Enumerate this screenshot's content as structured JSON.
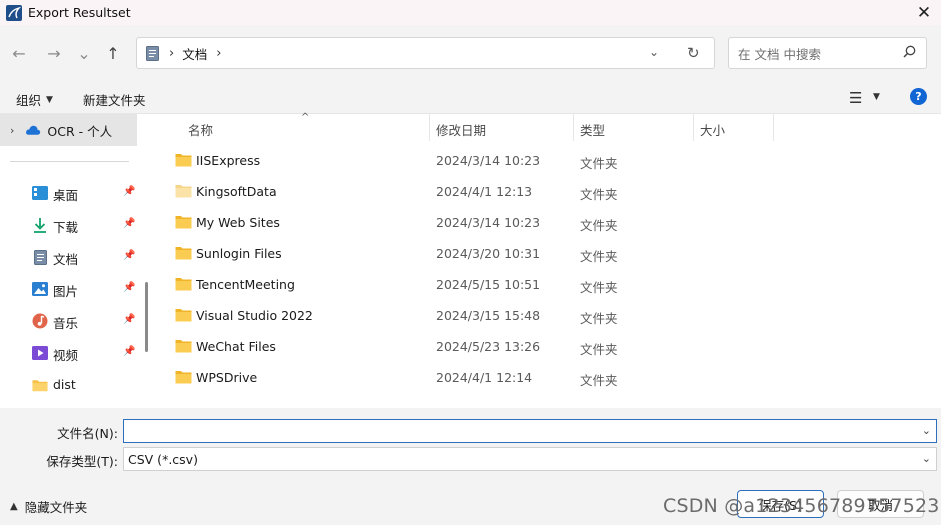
{
  "window": {
    "title": "Export Resultset",
    "close_label": "✕"
  },
  "nav": {
    "back": "←",
    "forward": "→",
    "recent": "⌄",
    "up": "↑",
    "address": {
      "separator": "›",
      "location": "文档",
      "trail": "›"
    },
    "search_placeholder": "在 文档 中搜索"
  },
  "toolbar": {
    "organize": "组织",
    "new_folder": "新建文件夹",
    "caret": "▼"
  },
  "sidebar": {
    "ocr_label": "OCR - 个人",
    "items": [
      {
        "label": "桌面",
        "icon": "desktop-icon",
        "pinned": true
      },
      {
        "label": "下载",
        "icon": "download-icon",
        "pinned": true
      },
      {
        "label": "文档",
        "icon": "documents-icon",
        "pinned": true
      },
      {
        "label": "图片",
        "icon": "pictures-icon",
        "pinned": true
      },
      {
        "label": "音乐",
        "icon": "music-icon",
        "pinned": true
      },
      {
        "label": "视频",
        "icon": "videos-icon",
        "pinned": true
      },
      {
        "label": "dist",
        "icon": "folder-icon",
        "pinned": false
      }
    ]
  },
  "columns": {
    "name": "名称",
    "date": "修改日期",
    "type": "类型",
    "size": "大小"
  },
  "files": [
    {
      "name": "IISExpress",
      "date": "2024/3/14 10:23",
      "type": "文件夹"
    },
    {
      "name": "KingsoftData",
      "date": "2024/4/1 12:13",
      "type": "文件夹"
    },
    {
      "name": "My Web Sites",
      "date": "2024/3/14 10:23",
      "type": "文件夹"
    },
    {
      "name": "Sunlogin Files",
      "date": "2024/3/20 10:31",
      "type": "文件夹"
    },
    {
      "name": "TencentMeeting",
      "date": "2024/5/15 10:51",
      "type": "文件夹"
    },
    {
      "name": "Visual Studio 2022",
      "date": "2024/3/15 15:48",
      "type": "文件夹"
    },
    {
      "name": "WeChat Files",
      "date": "2024/5/23 13:26",
      "type": "文件夹"
    },
    {
      "name": "WPSDrive",
      "date": "2024/4/1 12:14",
      "type": "文件夹"
    }
  ],
  "form": {
    "filename_label": "文件名(N):",
    "filename_value": "",
    "filetype_label": "保存类型(T):",
    "filetype_value": "CSV (*.csv)"
  },
  "footer": {
    "hide_folders": "隐藏文件夹",
    "save": "保存(S)",
    "cancel": "取消",
    "watermark": "CSDN @a123456789757523"
  },
  "colors": {
    "accent": "#2d6fbd",
    "folder": "#f7c14a",
    "folder_light": "#fbe3a8",
    "help": "#1166d4"
  }
}
